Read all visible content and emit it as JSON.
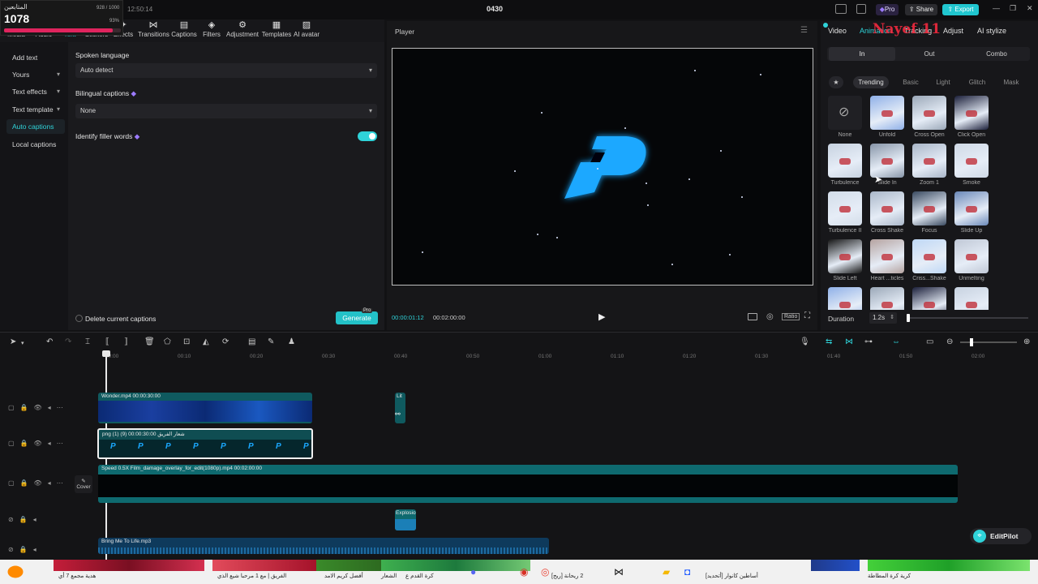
{
  "window": {
    "title": "0430",
    "time": "12:50:14",
    "pro_label": "Pro",
    "share_label": "Share",
    "export_label": "Export",
    "minimize": "—",
    "maximize": "❐",
    "close": "✕"
  },
  "stream_widget": {
    "title": "المتابعين",
    "count": "1078",
    "goal": "928 / 1000",
    "percent": "93%"
  },
  "toolbar": {
    "items": [
      {
        "label": "Media",
        "icon": "media-icon"
      },
      {
        "label": "Audio",
        "icon": "audio-icon"
      },
      {
        "label": "Text",
        "icon": "text-icon"
      },
      {
        "label": "Stickers",
        "icon": "stickers-icon"
      },
      {
        "label": "Effects",
        "icon": "effects-icon"
      },
      {
        "label": "Transitions",
        "icon": "transitions-icon"
      },
      {
        "label": "Captions",
        "icon": "captions-icon"
      },
      {
        "label": "Filters",
        "icon": "filters-icon"
      },
      {
        "label": "Adjustment",
        "icon": "adjustment-icon"
      },
      {
        "label": "Templates",
        "icon": "templates-icon"
      },
      {
        "label": "AI avatar",
        "icon": "ai-avatar-icon"
      }
    ]
  },
  "left_nav": {
    "items": [
      {
        "label": "Add text",
        "caret": false,
        "active": false
      },
      {
        "label": "Yours",
        "caret": true,
        "active": false
      },
      {
        "label": "Text effects",
        "caret": true,
        "active": false
      },
      {
        "label": "Text template",
        "caret": true,
        "active": false
      },
      {
        "label": "Auto captions",
        "caret": false,
        "active": true
      },
      {
        "label": "Local captions",
        "caret": false,
        "active": false
      }
    ]
  },
  "captions_panel": {
    "spoken_language_label": "Spoken language",
    "spoken_language_value": "Auto detect",
    "bilingual_label": "Bilingual captions",
    "bilingual_value": "None",
    "filler_label": "Identify filler words",
    "filler_enabled": true,
    "delete_label": "Delete current captions",
    "generate_label": "Generate",
    "generate_badge": "Pro"
  },
  "player": {
    "title": "Player",
    "current_time": "00:00:01:12",
    "total_time": "00:02:00:00",
    "ratio_label": "Ratio"
  },
  "right_panel": {
    "tabs": [
      "Video",
      "Animation",
      "Tracking",
      "Adjust",
      "AI stylize"
    ],
    "active_tab": "Animation",
    "overlay_text": "Nayef 11",
    "segments": [
      "In",
      "Out",
      "Combo"
    ],
    "active_segment": "In",
    "chips": [
      "Trending",
      "Basic",
      "Light",
      "Glitch",
      "Mask"
    ],
    "active_chip": "Trending",
    "presets": [
      "None",
      "Unfold",
      "Cross Open",
      "Click Open",
      "Turbulence",
      "Slide In",
      "Zoom 1",
      "Smoke",
      "Turbulence II",
      "Cross Shake",
      "Focus",
      "Slide Up",
      "Slide Left",
      "Heart ...ticles",
      "Criss...Shake",
      "Unmelting",
      "",
      "",
      "",
      ""
    ],
    "duration_label": "Duration",
    "duration_value": "1.2s"
  },
  "timeline": {
    "ruler": [
      "00:00",
      "00:10",
      "00:20",
      "00:30",
      "00:40",
      "00:50",
      "01:00",
      "01:10",
      "01:20",
      "01:30",
      "01:40",
      "01:50",
      "02:00"
    ],
    "cover_label": "Cover",
    "clips": {
      "wonder": "Wonder.mp4   00:00:30:00",
      "logo": "png (1) (9) شعار الفريق  00:00:30:00",
      "speed": "Speed 0.5X   Film_damage_overlay_for_edit(1080p).mp4   00:02:00:00",
      "lit": "Lit",
      "explosion": "Explosio",
      "audio": "Bring Me To Life.mp3"
    }
  },
  "editpilot": {
    "label": "EditPilot"
  },
  "taskbar": {
    "captions": [
      "هدية مجمع 7 أي",
      "الفريق | مع 1 مرحبا شيع الذي",
      "أفضل كريم الامد",
      "الشعار",
      "كرة القدم ع",
      "[ريح] 2 ريحانة",
      "[أتحديد] أساطين كانوار",
      "كرية كرة المطاطة"
    ]
  },
  "colors": {
    "accent": "#2fd3d9",
    "export": "#20c6cf",
    "pro": "#7b4bff",
    "overlay_text": "#ff2a40",
    "logo_blue": "#1aa8ff"
  }
}
